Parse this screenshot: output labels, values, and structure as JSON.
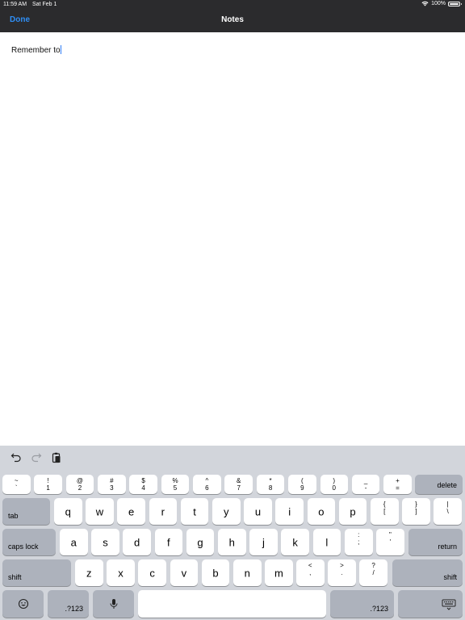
{
  "status_bar": {
    "time": "11:59 AM",
    "date": "Sat Feb 1",
    "battery_text": "100%",
    "battery_level": 1.0
  },
  "nav": {
    "done_label": "Done",
    "title": "Notes"
  },
  "note": {
    "text": "Remember to"
  },
  "colors": {
    "accent": "#2f8ef5",
    "topbar": "#2b2b2d",
    "keyboard_bg": "#d2d5db",
    "key": "#ffffff",
    "fn_key": "#adb2bc"
  },
  "shortcut_bar": {
    "icons": [
      "undo-icon",
      "redo-icon",
      "paste-icon"
    ]
  },
  "keyboard": {
    "row1": [
      {
        "top": "~",
        "bottom": "`"
      },
      {
        "top": "!",
        "bottom": "1"
      },
      {
        "top": "@",
        "bottom": "2"
      },
      {
        "top": "#",
        "bottom": "3"
      },
      {
        "top": "$",
        "bottom": "4"
      },
      {
        "top": "%",
        "bottom": "5"
      },
      {
        "top": "^",
        "bottom": "6"
      },
      {
        "top": "&",
        "bottom": "7"
      },
      {
        "top": "*",
        "bottom": "8"
      },
      {
        "top": "(",
        "bottom": "9"
      },
      {
        "top": ")",
        "bottom": "0"
      },
      {
        "top": "_",
        "bottom": "-"
      },
      {
        "top": "+",
        "bottom": "="
      }
    ],
    "delete": "delete",
    "tab": "tab",
    "row2_letters": [
      "q",
      "w",
      "e",
      "r",
      "t",
      "y",
      "u",
      "i",
      "o",
      "p"
    ],
    "row2_symbols": [
      {
        "top": "{",
        "bottom": "["
      },
      {
        "top": "}",
        "bottom": "]"
      },
      {
        "top": "|",
        "bottom": "\\"
      }
    ],
    "caps_lock": "caps lock",
    "row3_letters": [
      "a",
      "s",
      "d",
      "f",
      "g",
      "h",
      "j",
      "k",
      "l"
    ],
    "row3_symbols": [
      {
        "top": ":",
        "bottom": ";"
      },
      {
        "top": "\"",
        "bottom": "'"
      }
    ],
    "return": "return",
    "shift": "shift",
    "row4_letters": [
      "z",
      "x",
      "c",
      "v",
      "b",
      "n",
      "m"
    ],
    "row4_symbols": [
      {
        "top": "<",
        "bottom": ","
      },
      {
        "top": ">",
        "bottom": "."
      },
      {
        "top": "?",
        "bottom": "/"
      }
    ],
    "numbers_key": ".?123",
    "bottom_icons": [
      "emoji-icon",
      "microphone-icon",
      "keyboard-dismiss-icon"
    ]
  }
}
